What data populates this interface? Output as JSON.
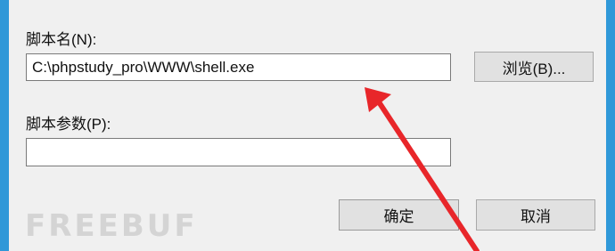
{
  "dialog": {
    "script_name_label": "脚本名(N):",
    "script_name_value": "C:\\phpstudy_pro\\WWW\\shell.exe",
    "browse_label": "浏览(B)...",
    "script_params_label": "脚本参数(P):",
    "script_params_value": "",
    "ok_label": "确定",
    "cancel_label": "取消"
  },
  "watermark": {
    "text": "FREEBUF"
  },
  "annotation": {
    "arrow_color": "#e8262a"
  },
  "colors": {
    "window_border": "#2f98d8",
    "dialog_background": "#f0f0f0"
  }
}
